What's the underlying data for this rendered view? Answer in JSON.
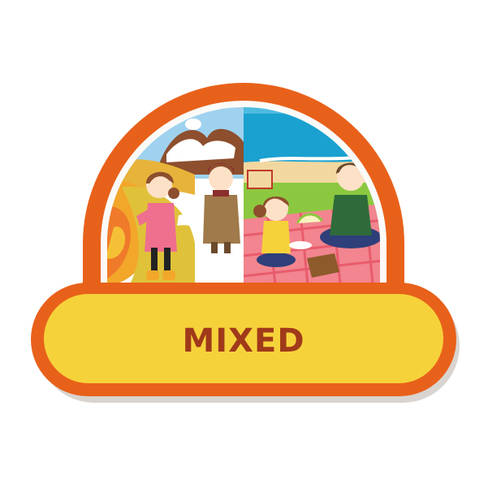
{
  "badge": {
    "label": "MIXED",
    "colors": {
      "outer_ring": "#e8611a",
      "rim": "#fbfaf7",
      "shadow": "#d9d4cf",
      "pill_fill": "#f6d23a",
      "label": "#a03a1a",
      "winter_sky": "#9fd2ee",
      "autumn": "#f2a72a",
      "sea": "#1aa1cf",
      "picnic_blanket": "#f2858f",
      "grass": "#8cc83f"
    },
    "scenes": [
      {
        "name": "winter-autumn",
        "icons": [
          "girl-pink-coat",
          "girl-brown-coat",
          "snowy-hill",
          "autumn-tree"
        ]
      },
      {
        "name": "summer-picnic",
        "icons": [
          "girl-yellow-shirt",
          "father-green-shirt",
          "picnic-basket",
          "watermelon",
          "sea"
        ]
      }
    ]
  }
}
